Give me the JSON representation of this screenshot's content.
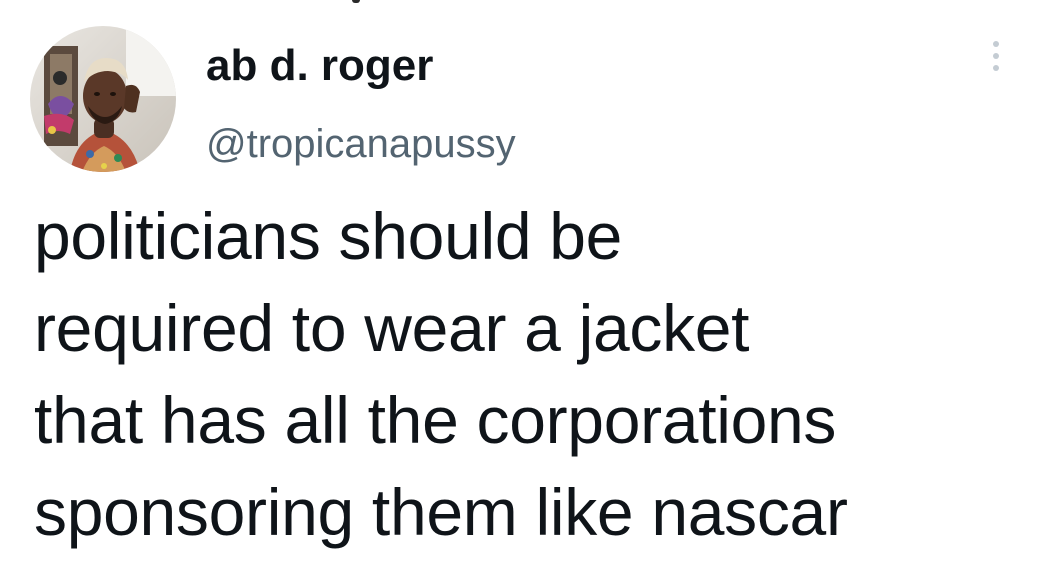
{
  "tweet": {
    "author": {
      "display_name": "ab d. roger",
      "handle": "@tropicanapussy",
      "avatar_icon": "profile-photo"
    },
    "more_icon": "vertical-ellipsis-icon",
    "text_lines": [
      "politicians should be",
      "required to wear a jacket",
      "that has all the corporations",
      "sponsoring them like nascar"
    ]
  },
  "colors": {
    "background": "#ffffff",
    "text_primary": "#0f1419",
    "text_secondary": "#536471",
    "more_dots": "#c4ccd3"
  }
}
